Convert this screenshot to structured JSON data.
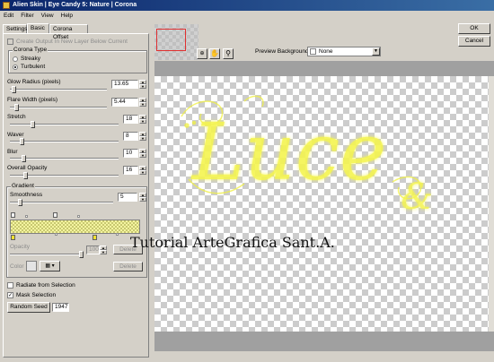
{
  "window": {
    "title": "Alien Skin | Eye Candy 5: Nature | Corona"
  },
  "menu": [
    "Edit",
    "Filter",
    "View",
    "Help"
  ],
  "tabs": [
    "Settings",
    "Basic",
    "Corona Offset"
  ],
  "basic": {
    "create_output_label": "Create Output In New Layer Below Current",
    "corona_type": {
      "group_label": "Corona Type",
      "options": [
        "Streaky",
        "Turbulent"
      ],
      "selected": "Turbulent"
    },
    "sliders": [
      {
        "label": "Glow Radius (pixels)",
        "value": "13.65"
      },
      {
        "label": "Flare Width (pixels)",
        "value": "5.44"
      },
      {
        "label": "Stretch",
        "value": "18"
      },
      {
        "label": "Waver",
        "value": "8"
      },
      {
        "label": "Blur",
        "value": "10"
      },
      {
        "label": "Overall Opacity",
        "value": "16"
      }
    ],
    "gradient": {
      "group_label": "Gradient",
      "smoothness_label": "Smoothness",
      "smoothness_value": "5",
      "opacity_label": "Opacity",
      "opacity_value": "100",
      "color_label": "Color",
      "delete_label": "Delete"
    },
    "radiate_label": "Radiate from Selection",
    "mask_label": "Mask Selection",
    "random_seed_label": "Random Seed",
    "random_seed_value": "1947"
  },
  "preview": {
    "background_label": "Preview Background:",
    "background_value": "None"
  },
  "buttons": {
    "ok": "OK",
    "cancel": "Cancel"
  },
  "canvas": {
    "word": "Luce",
    "ampersand": "&",
    "watermark": "Tutorial ArteGrafica Sant.A."
  },
  "colors": {
    "glow": "#f0f040",
    "titlebar": "#0a246a"
  }
}
